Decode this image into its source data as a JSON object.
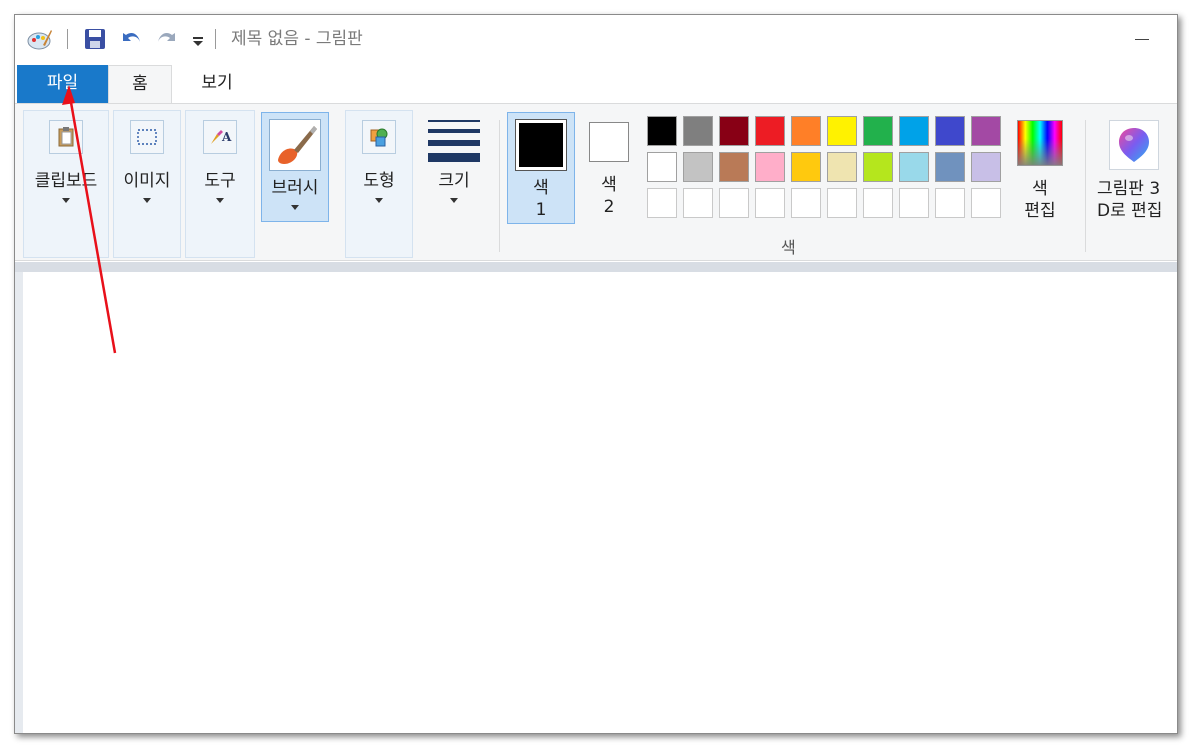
{
  "window": {
    "title": "제목 없음 - 그림판"
  },
  "tabs": {
    "file": "파일",
    "home": "홈",
    "view": "보기"
  },
  "ribbon": {
    "clipboard": "클립보드",
    "image": "이미지",
    "tools": "도구",
    "brushes": "브러시",
    "shapes": "도형",
    "size": "크기",
    "color1_top": "색",
    "color1_bottom": "1",
    "color2_top": "색",
    "color2_bottom": "2",
    "edit_colors_top": "색",
    "edit_colors_bottom": "편집",
    "colors_group_label": "색",
    "paint3d_top": "그림판 3",
    "paint3d_bottom": "D로 편집"
  },
  "palette": {
    "row1": [
      "#000000",
      "#7f7f7f",
      "#880015",
      "#ed1c24",
      "#ff7f27",
      "#fff200",
      "#22b14c",
      "#00a2e8",
      "#3f48cc",
      "#a349a4"
    ],
    "row2": [
      "#ffffff",
      "#c3c3c3",
      "#b97a57",
      "#ffaec9",
      "#ffc90e",
      "#efe4b0",
      "#b5e61d",
      "#99d9ea",
      "#7092be",
      "#c8bfe7"
    ],
    "row3": [
      "#ffffff",
      "#ffffff",
      "#ffffff",
      "#ffffff",
      "#ffffff",
      "#ffffff",
      "#ffffff",
      "#ffffff",
      "#ffffff",
      "#ffffff"
    ]
  },
  "colors": {
    "file_tab_bg": "#1979ca",
    "annotation_arrow": "#e8101a"
  }
}
